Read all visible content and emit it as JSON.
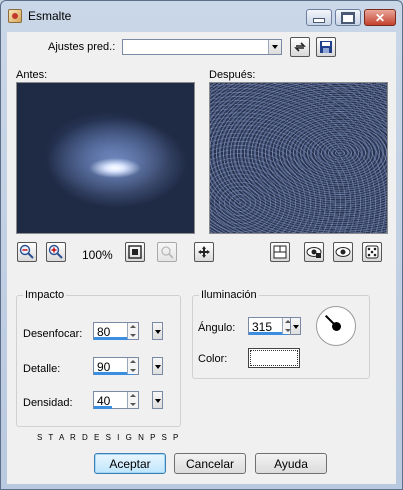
{
  "window": {
    "title": "Esmalte"
  },
  "presets": {
    "label": "Ajustes pred.:",
    "value": ""
  },
  "previews": {
    "before_label": "Antes:",
    "after_label": "Después:"
  },
  "zoom": {
    "level": "100%"
  },
  "impacto": {
    "title": "Impacto",
    "fields": [
      {
        "label": "Desenfocar:",
        "value": "80",
        "fill": 0.8
      },
      {
        "label": "Detalle:",
        "value": "90",
        "fill": 0.9
      },
      {
        "label": "Densidad:",
        "value": "40",
        "fill": 0.4
      }
    ]
  },
  "iluminacion": {
    "title": "Iluminación",
    "angle_label": "Ángulo:",
    "angle_value": "315",
    "angle_fill": 0.875,
    "color_label": "Color:"
  },
  "watermark": "S T A R D E S I G N P S P",
  "buttons": {
    "ok": "Aceptar",
    "cancel": "Cancelar",
    "help": "Ayuda"
  },
  "icons": {
    "app": "app-icon",
    "minimize": "minimize-icon",
    "maximize": "maximize-icon",
    "close": "close-icon",
    "reset": "reset-icon",
    "save": "save-preset-icon",
    "zoom_out": "zoom-out-icon",
    "zoom_in": "zoom-in-icon",
    "fit": "fit-window-icon",
    "proof": "proof-icon",
    "pan": "pan-icon",
    "layout": "preview-layout-icon",
    "auto_proof": "auto-proof-icon",
    "show_proof": "show-proof-icon",
    "random": "randomize-icon"
  }
}
